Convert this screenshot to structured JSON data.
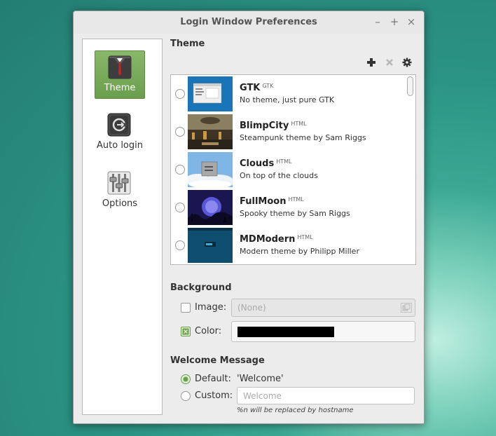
{
  "window": {
    "title": "Login Window Preferences",
    "controls": {
      "minimize": "–",
      "maximize": "+",
      "close": "×"
    }
  },
  "sidebar": {
    "items": [
      {
        "label": "Theme",
        "icon": "suit-icon",
        "selected": true
      },
      {
        "label": "Auto login",
        "icon": "auto-login-icon",
        "selected": false
      },
      {
        "label": "Options",
        "icon": "sliders-icon",
        "selected": false
      }
    ]
  },
  "theme": {
    "title": "Theme",
    "toolbar": {
      "add": "add-icon",
      "remove": "remove-icon",
      "settings": "gear-icon"
    },
    "items": [
      {
        "name": "GTK",
        "type": "GTK",
        "description": "No theme, just pure GTK",
        "selected": false
      },
      {
        "name": "BlimpCity",
        "type": "HTML",
        "description": "Steampunk theme by Sam Riggs",
        "selected": false
      },
      {
        "name": "Clouds",
        "type": "HTML",
        "description": "On top of the clouds",
        "selected": false
      },
      {
        "name": "FullMoon",
        "type": "HTML",
        "description": "Spooky theme by Sam Riggs",
        "selected": false
      },
      {
        "name": "MDModern",
        "type": "HTML",
        "description": "Modern theme by Philipp Miller",
        "selected": false
      }
    ]
  },
  "background": {
    "title": "Background",
    "image_label": "Image:",
    "image_placeholder": "(None)",
    "image_checked": false,
    "color_label": "Color:",
    "color_checked": true,
    "color_value": "#000000"
  },
  "welcome": {
    "title": "Welcome Message",
    "default_label": "Default:",
    "default_value": "'Welcome'",
    "default_checked": true,
    "custom_label": "Custom:",
    "custom_placeholder": "Welcome",
    "hint": "%n will be replaced by hostname"
  },
  "colors": {
    "accent": "#6a9e4c",
    "desktop": "#2b9384"
  }
}
